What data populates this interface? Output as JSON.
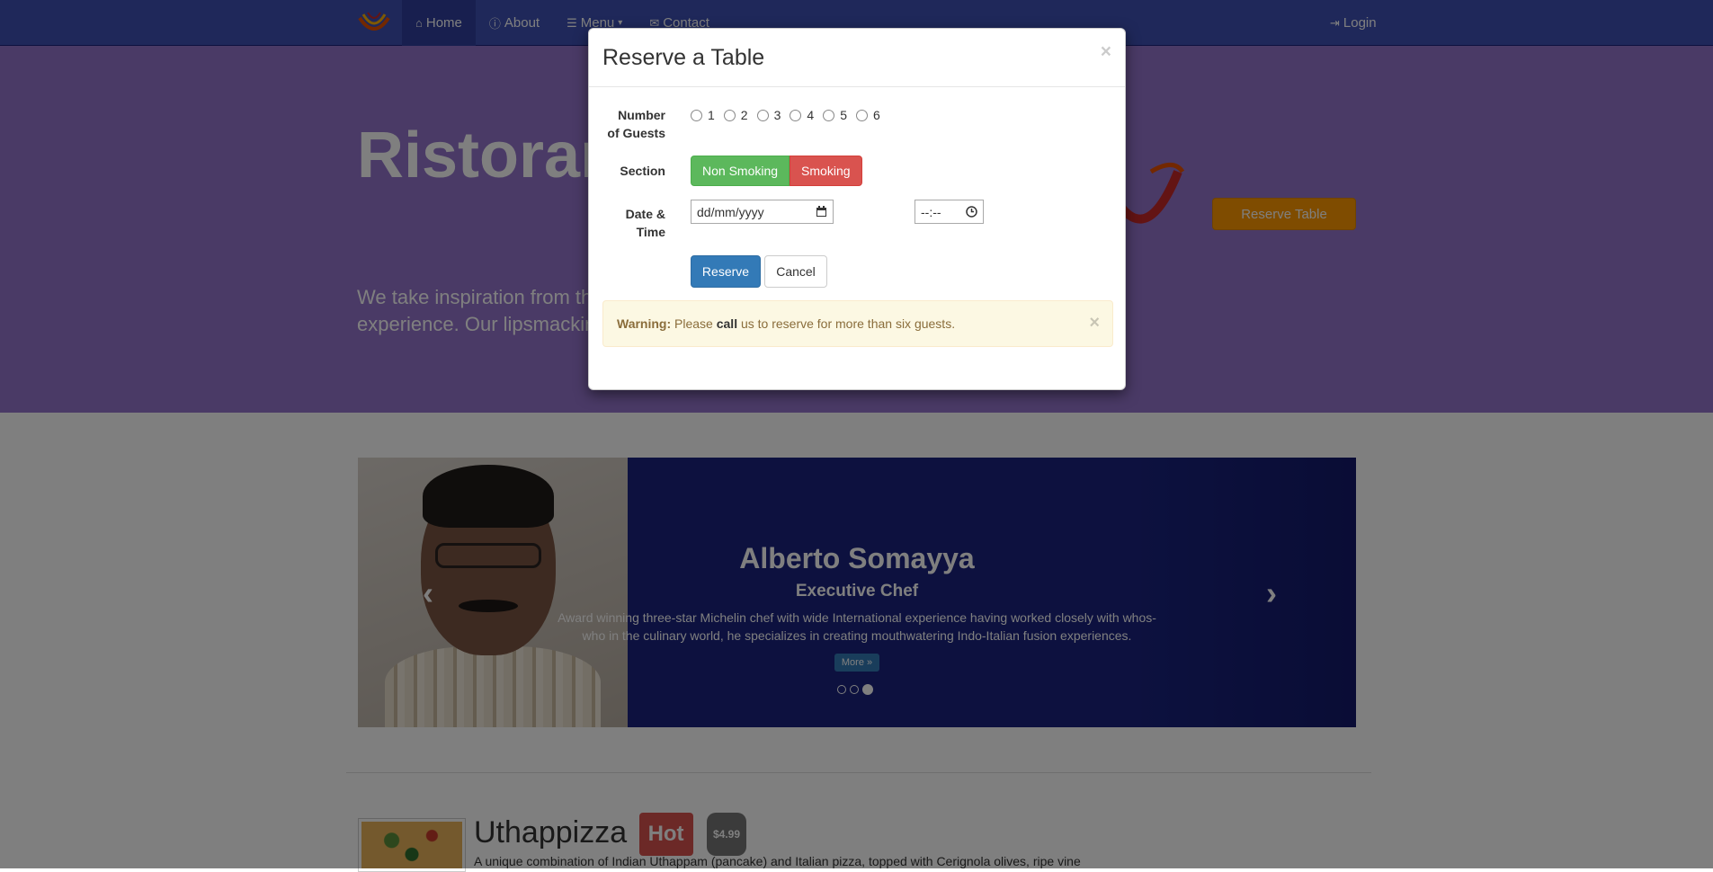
{
  "navbar": {
    "brand_icon": "ristorante-logo",
    "items": [
      {
        "label": "Home",
        "icon": "home-icon",
        "active": true
      },
      {
        "label": "About",
        "icon": "info-icon"
      },
      {
        "label": "Menu",
        "icon": "list-icon",
        "caret": true
      },
      {
        "label": "Contact",
        "icon": "envelope-icon"
      }
    ],
    "login": {
      "label": "Login",
      "icon": "sign-in-icon"
    }
  },
  "jumbotron": {
    "title": "Ristorant",
    "text_line1": "We take inspiration from the",
    "text_line2": "experience. Our lipsmacking",
    "reserve_button": "Reserve Table"
  },
  "carousel": {
    "name": "Alberto Somayya",
    "role": "Executive Chef",
    "description": "Award winning three-star Michelin chef with wide International experience having worked closely with whos-who in the culinary world, he specializes in creating mouthwatering Indo-Italian fusion experiences.",
    "more_button": "More »",
    "indicators": 3,
    "active_indicator": 3
  },
  "featured": {
    "title": "Uthappizza",
    "label": "Hot",
    "price": "$4.99",
    "description": "A unique combination of Indian Uthappam (pancake) and Italian pizza, topped with Cerignola olives, ripe vine"
  },
  "modal": {
    "title": "Reserve a Table",
    "close": "×",
    "guests_label_line1": "Number",
    "guests_label_line2": "of Guests",
    "guest_options": [
      "1",
      "2",
      "3",
      "4",
      "5",
      "6"
    ],
    "section_label": "Section",
    "section_options": [
      "Non Smoking",
      "Smoking"
    ],
    "datetime_label_line1": "Date &",
    "datetime_label_line2": "Time",
    "date_placeholder": "dd/mm/yyyy",
    "time_placeholder": "--:--",
    "reserve_button": "Reserve",
    "cancel_button": "Cancel",
    "alert": {
      "strong": "Warning:",
      "pre": " Please ",
      "bold": "call",
      "post": " us to reserve for more than six guests.",
      "close": "×"
    }
  },
  "colors": {
    "navbar": "#3f51b5",
    "jumbotron": "#9575cd",
    "carousel": "#1a237e",
    "accent_orange": "#ff9800",
    "success": "#5cb85c",
    "danger": "#d9534f",
    "primary": "#337ab7"
  }
}
